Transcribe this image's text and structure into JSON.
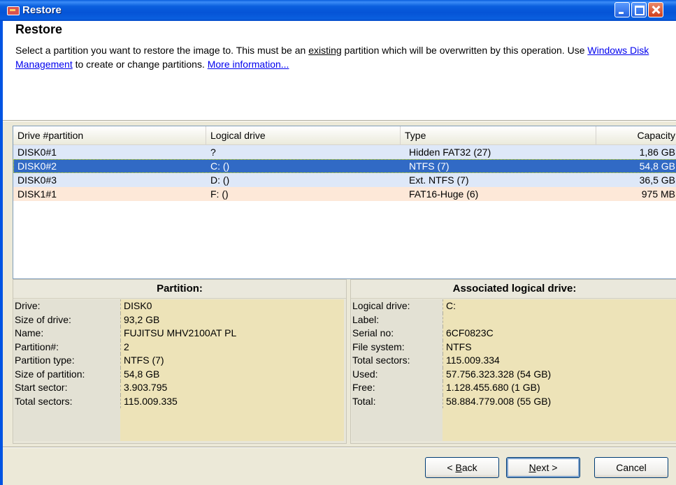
{
  "window": {
    "title": "Restore"
  },
  "header": {
    "heading": "Restore",
    "desc_part1": "Select a partition you want to restore the image to. This must be an ",
    "desc_existing": "existing",
    "desc_part2": " partition which will be overwritten by this operation. Use ",
    "link_disk_mgmt": "Windows Disk Management",
    "desc_part3": " to create or change partitions. ",
    "link_more_info": "More information..."
  },
  "list": {
    "columns": [
      "Drive #partition",
      "Logical drive",
      "Type",
      "Capacity"
    ],
    "rows": [
      {
        "drive": "DISK0#1",
        "logical": "?",
        "type": "Hidden FAT32 (27)",
        "capacity": "1,86 GB"
      },
      {
        "drive": "DISK0#2",
        "logical": "C: ()",
        "type": "NTFS (7)",
        "capacity": "54,8 GB"
      },
      {
        "drive": "DISK0#3",
        "logical": "D: ()",
        "type": "Ext. NTFS (7)",
        "capacity": "36,5 GB"
      },
      {
        "drive": "DISK1#1",
        "logical": "F: ()",
        "type": "FAT16-Huge (6)",
        "capacity": "975 MB"
      }
    ],
    "selected_row": 1
  },
  "partition": {
    "title": "Partition:",
    "items": [
      {
        "label": "Drive:",
        "value": "DISK0"
      },
      {
        "label": "Size of drive:",
        "value": "93,2 GB"
      },
      {
        "label": "Name:",
        "value": "FUJITSU MHV2100AT PL"
      },
      {
        "label": "Partition#:",
        "value": "2"
      },
      {
        "label": "Partition type:",
        "value": "NTFS (7)"
      },
      {
        "label": "Size of partition:",
        "value": "54,8 GB"
      },
      {
        "label": "Start sector:",
        "value": "3.903.795"
      },
      {
        "label": "Total sectors:",
        "value": "115.009.335"
      }
    ]
  },
  "logical_drive": {
    "title": "Associated logical drive:",
    "items": [
      {
        "label": "Logical drive:",
        "value": "C:"
      },
      {
        "label": "Label:",
        "value": ""
      },
      {
        "label": "Serial no:",
        "value": "6CF0823C"
      },
      {
        "label": "File system:",
        "value": "NTFS"
      },
      {
        "label": "Total sectors:",
        "value": "115.009.334"
      },
      {
        "label": "Used:",
        "value": "57.756.323.328 (54 GB)"
      },
      {
        "label": "Free:",
        "value": "1.128.455.680 (1 GB)"
      },
      {
        "label": "Total:",
        "value": "58.884.779.008 (55 GB)"
      }
    ]
  },
  "buttons": {
    "back_prefix": "< ",
    "back_mnemonic": "B",
    "back_rest": "ack",
    "next_mnemonic": "N",
    "next_rest": "ext >",
    "cancel": "Cancel"
  },
  "colors": {
    "selection": "#316ac5",
    "row_blue": "#dee8f8",
    "row_peach": "#fde8d8",
    "value_bg": "#ede3b8",
    "titlebar": "#0a5fde"
  }
}
